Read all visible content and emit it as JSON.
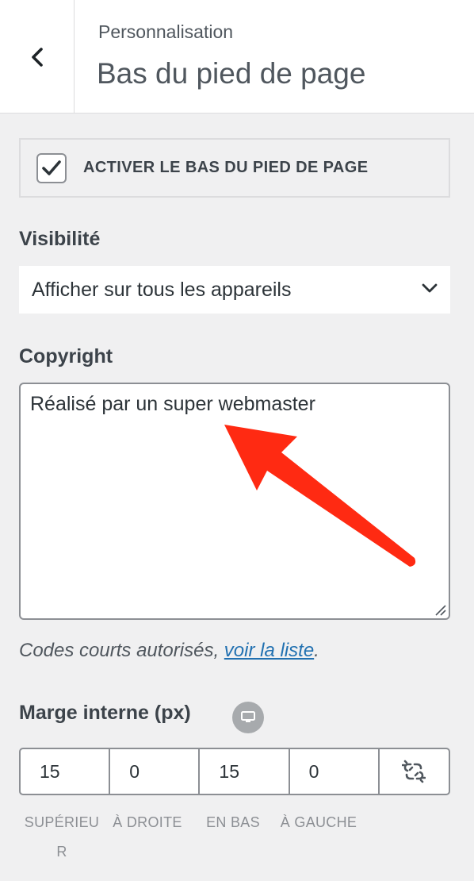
{
  "header": {
    "section": "Personnalisation",
    "title": "Bas du pied de page",
    "back_icon": "chevron-left-icon"
  },
  "toggle": {
    "label": "ACTIVER LE BAS DU PIED DE PAGE",
    "checked": true
  },
  "visibility": {
    "label": "Visibilité",
    "selected": "Afficher sur tous les appareils"
  },
  "copyright": {
    "label": "Copyright",
    "value": "Réalisé par un super webmaster"
  },
  "help": {
    "text": "Codes courts autorisés, ",
    "link": "voir la liste",
    "suffix": "."
  },
  "padding": {
    "label": "Marge interne (px)",
    "device_icon": "desktop-icon",
    "values": {
      "top": "15",
      "right": "0",
      "bottom": "15",
      "left": "0"
    },
    "labels": {
      "top": "SUPÉRIEUR",
      "right": "À DROITE",
      "bottom": "EN BAS",
      "left": "À GAUCHE"
    },
    "link_icon": "unlink-icon"
  },
  "colors": {
    "accent": "#2271b1",
    "annotation_arrow": "#ff2a12"
  }
}
